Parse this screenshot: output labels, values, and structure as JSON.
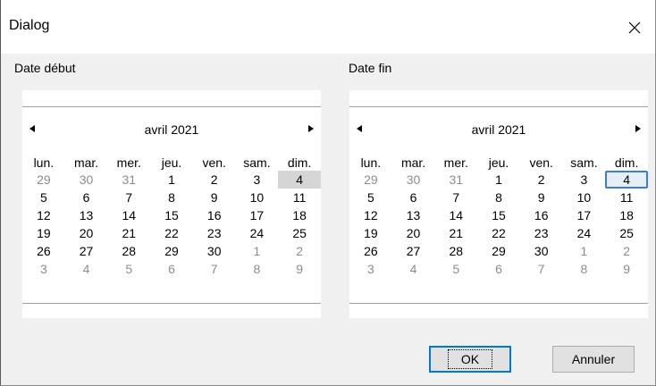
{
  "window": {
    "title": "Dialog"
  },
  "start": {
    "label": "Date début",
    "month_label": "avril 2021",
    "weekdays": [
      "lun.",
      "mar.",
      "mer.",
      "jeu.",
      "ven.",
      "sam.",
      "dim."
    ],
    "weeks": [
      [
        "29",
        "30",
        "31",
        "1",
        "2",
        "3",
        "4"
      ],
      [
        "5",
        "6",
        "7",
        "8",
        "9",
        "10",
        "11"
      ],
      [
        "12",
        "13",
        "14",
        "15",
        "16",
        "17",
        "18"
      ],
      [
        "19",
        "20",
        "21",
        "22",
        "23",
        "24",
        "25"
      ],
      [
        "26",
        "27",
        "28",
        "29",
        "30",
        "1",
        "2"
      ],
      [
        "3",
        "4",
        "5",
        "6",
        "7",
        "8",
        "9"
      ]
    ],
    "selected_day": "4"
  },
  "end": {
    "label": "Date fin",
    "month_label": "avril 2021",
    "weekdays": [
      "lun.",
      "mar.",
      "mer.",
      "jeu.",
      "ven.",
      "sam.",
      "dim."
    ],
    "weeks": [
      [
        "29",
        "30",
        "31",
        "1",
        "2",
        "3",
        "4"
      ],
      [
        "5",
        "6",
        "7",
        "8",
        "9",
        "10",
        "11"
      ],
      [
        "12",
        "13",
        "14",
        "15",
        "16",
        "17",
        "18"
      ],
      [
        "19",
        "20",
        "21",
        "22",
        "23",
        "24",
        "25"
      ],
      [
        "26",
        "27",
        "28",
        "29",
        "30",
        "1",
        "2"
      ],
      [
        "3",
        "4",
        "5",
        "6",
        "7",
        "8",
        "9"
      ]
    ],
    "selected_day": "4"
  },
  "buttons": {
    "ok": "OK",
    "cancel": "Annuler"
  },
  "icons": {
    "close": "close-icon",
    "prev": "triangle-left-icon",
    "next": "triangle-right-icon"
  },
  "colors": {
    "selected": "#d5d5d5",
    "focus": "#3b7dd8",
    "default_button": "#0078d7"
  }
}
